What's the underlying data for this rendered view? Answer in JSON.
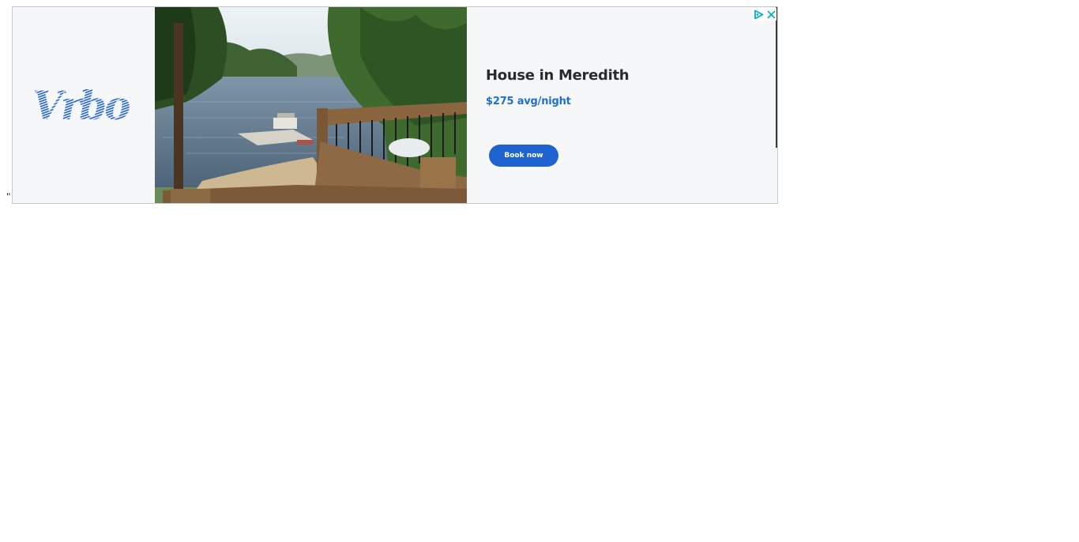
{
  "page": {
    "stray_text": "\""
  },
  "ad": {
    "brand": {
      "name": "Vrbo",
      "icon": "vrbo-logo-icon",
      "color": "#1f63d3"
    },
    "listing_photo": {
      "icon": "lake-house-photo"
    },
    "title": "House in Meredith",
    "price": "$275 avg/night",
    "cta_label": "Book now",
    "cta_color": "#1f63d3",
    "adchoices": {
      "play_icon": "adchoices-triangle-icon",
      "close_icon": "close-icon",
      "color": "#00aecd"
    }
  }
}
